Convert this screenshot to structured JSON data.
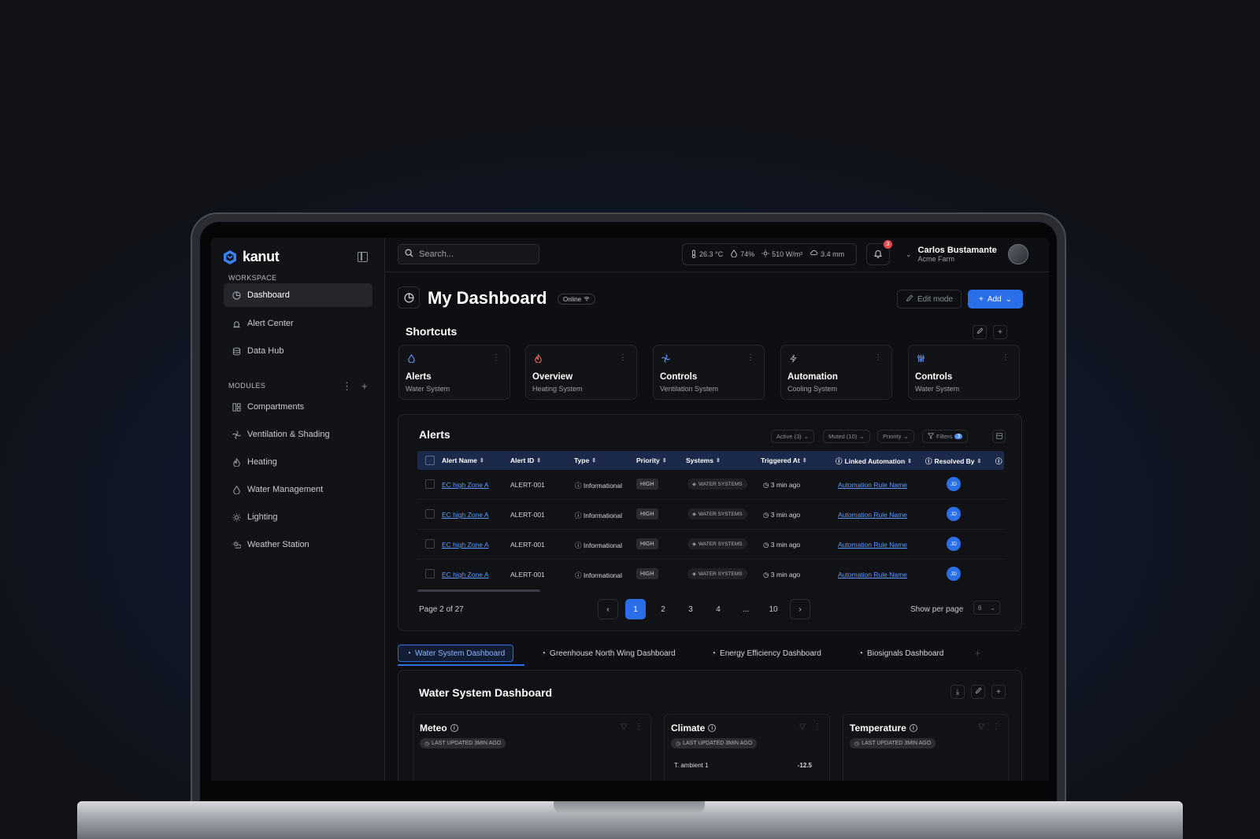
{
  "app": {
    "name": "kanut"
  },
  "sidebar": {
    "workspace_label": "WORKSPACE",
    "workspace_items": [
      {
        "label": "Dashboard",
        "icon": "pie-chart-icon",
        "active": true
      },
      {
        "label": "Alert Center",
        "icon": "siren-icon"
      },
      {
        "label": "Data Hub",
        "icon": "database-icon"
      }
    ],
    "modules_label": "MODULES",
    "module_items": [
      {
        "label": "Compartments",
        "icon": "grid-icon"
      },
      {
        "label": "Ventilation & Shading",
        "icon": "fan-icon"
      },
      {
        "label": "Heating",
        "icon": "flame-icon"
      },
      {
        "label": "Water Management",
        "icon": "water-icon"
      },
      {
        "label": "Lighting",
        "icon": "sun-icon"
      },
      {
        "label": "Weather Station",
        "icon": "weather-icon"
      }
    ]
  },
  "topbar": {
    "search_placeholder": "Search...",
    "metrics": {
      "temperature": "26.3 °C",
      "humidity": "74%",
      "radiation": "510 W/m²",
      "rain": "3.4 mm"
    },
    "notifications_count": "3",
    "user_name": "Carlos Bustamante",
    "user_org": "Acme Farm"
  },
  "header": {
    "title": "My Dashboard",
    "status": "Online",
    "edit_mode_label": "Edit mode",
    "add_label": "Add"
  },
  "shortcuts": {
    "title": "Shortcuts",
    "items": [
      {
        "title": "Alerts",
        "subtitle": "Water System",
        "icon": "water-icon"
      },
      {
        "title": "Overview",
        "subtitle": "Heating System",
        "icon": "flame-icon"
      },
      {
        "title": "Controls",
        "subtitle": "Ventilation System",
        "icon": "fan-icon"
      },
      {
        "title": "Automation",
        "subtitle": "Cooling System",
        "icon": "bolt-icon"
      },
      {
        "title": "Controls",
        "subtitle": "Water System",
        "icon": "sliders-icon"
      }
    ]
  },
  "alerts": {
    "title": "Alerts",
    "filters": {
      "active": "Active (3)",
      "muted": "Muted (10)",
      "priority": "Priority",
      "filters": "Filters",
      "filters_count": "3"
    },
    "columns": [
      "Alert Name",
      "Alert ID",
      "Type",
      "Priority",
      "Systems",
      "Triggered At",
      "Linked Automation",
      "Resolved By"
    ],
    "rows": [
      {
        "name": "EC high Zone A",
        "id": "ALERT-001",
        "type": "Informational",
        "priority": "HIGH",
        "system": "WATER SYSTEMS",
        "triggered": "3 min ago",
        "automation": "Automation Rule Name",
        "resolved_by": "JD"
      },
      {
        "name": "EC high Zone A",
        "id": "ALERT-001",
        "type": "Informational",
        "priority": "HIGH",
        "system": "WATER SYSTEMS",
        "triggered": "3 min ago",
        "automation": "Automation Rule Name",
        "resolved_by": "JD"
      },
      {
        "name": "EC high Zone A",
        "id": "ALERT-001",
        "type": "Informational",
        "priority": "HIGH",
        "system": "WATER SYSTEMS",
        "triggered": "3 min ago",
        "automation": "Automation Rule Name",
        "resolved_by": "JD"
      },
      {
        "name": "EC high Zone A",
        "id": "ALERT-001",
        "type": "Informational",
        "priority": "HIGH",
        "system": "WATER SYSTEMS",
        "triggered": "3 min ago",
        "automation": "Automation Rule Name",
        "resolved_by": "JD"
      }
    ],
    "pagination": {
      "text": "Page 2 of 27",
      "pages": [
        "1",
        "2",
        "3",
        "4",
        "...",
        "10"
      ],
      "active_page": "1",
      "show_per_page_label": "Show per page",
      "per_page": "6"
    }
  },
  "tabs": [
    {
      "label": "Water System Dashboard",
      "active": true
    },
    {
      "label": "Greenhouse North Wing Dashboard"
    },
    {
      "label": "Energy Efficiency Dashboard"
    },
    {
      "label": "Biosignals Dashboard"
    }
  ],
  "water_dashboard": {
    "title": "Water System Dashboard",
    "widgets": [
      {
        "title": "Meteo",
        "updated": "LAST UPDATED 3MIN AGO"
      },
      {
        "title": "Climate",
        "updated": "LAST UPDATED 3MIN AGO",
        "row_label": "T. ambient 1",
        "row_value": "-12.5"
      },
      {
        "title": "Temperature",
        "updated": "LAST UPDATED 3MIN AGO"
      }
    ]
  },
  "colors": {
    "accent": "#2b6fe8",
    "link": "#5c9bff",
    "badge": "#e5484d"
  }
}
